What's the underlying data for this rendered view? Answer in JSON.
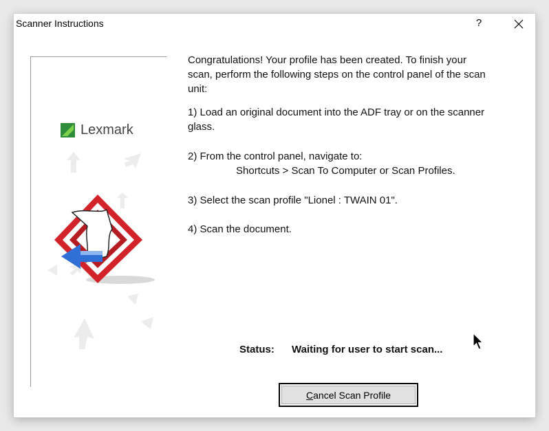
{
  "window": {
    "title": "Scanner Instructions",
    "help_label": "?",
    "close_icon": "close-icon"
  },
  "branding": {
    "logo_text": "Lexmark",
    "brand_color": "#2e8b3a",
    "accent_red": "#d2232a",
    "accent_blue": "#2f6fd6"
  },
  "instructions": {
    "intro_lines": [
      "Congratulations! Your profile has been created. To finish your",
      "scan, perform the following steps on the control panel of the scan",
      "unit:"
    ],
    "step1_lines": [
      "1)  Load an original document into the ADF tray or on the scanner",
      "glass."
    ],
    "step2_line1": "2)  From the control panel, navigate to:",
    "step2_line2": "Shortcuts > Scan To Computer or Scan Profiles.",
    "step3": "3) Select the scan profile \"Lionel : TWAIN 01\".",
    "step4": "4) Scan the document."
  },
  "status": {
    "label": "Status:",
    "value": "Waiting for user to start scan..."
  },
  "buttons": {
    "cancel_mnemonic": "C",
    "cancel_rest": "ancel Scan Profile"
  }
}
